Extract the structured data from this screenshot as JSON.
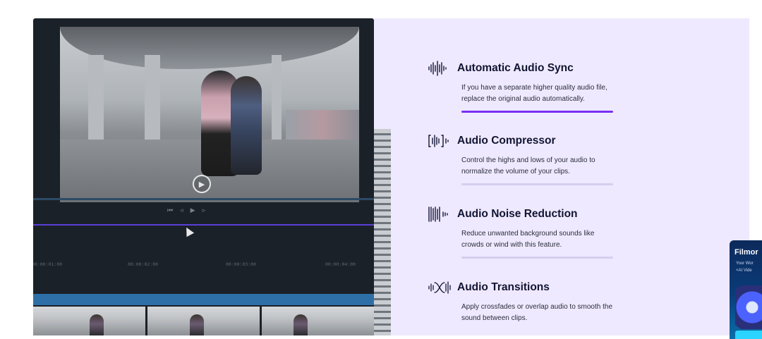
{
  "editor": {
    "controls": [
      "⏮",
      "◃",
      "▶",
      "▹"
    ],
    "timecodes": [
      "00:00:01:00",
      "00:00:02:00",
      "00:00:03:00",
      "00:00:04:00"
    ]
  },
  "features": [
    {
      "title": "Automatic Audio Sync",
      "desc": "If you have a separate higher quality audio file, replace the original audio automatically.",
      "icon": "waveform-sync-icon",
      "active": true
    },
    {
      "title": "Audio Compressor",
      "desc": "Control the highs and lows of your audio to normalize the volume of your clips.",
      "icon": "audio-compressor-icon",
      "active": false
    },
    {
      "title": "Audio Noise Reduction",
      "desc": "Reduce unwanted background sounds like crowds or wind with this feature.",
      "icon": "noise-reduction-icon",
      "active": false
    },
    {
      "title": "Audio Transitions",
      "desc": "Apply crossfades or overlap audio to smooth the sound between clips.",
      "icon": "audio-transition-icon",
      "active": false
    }
  ],
  "ad": {
    "brand": "Filmor",
    "line1": "Your Wor",
    "line2": "×AI Vide"
  },
  "colors": {
    "accent": "#7a2ff2",
    "background_panel": "#efe9ff",
    "title_text": "#111533"
  }
}
